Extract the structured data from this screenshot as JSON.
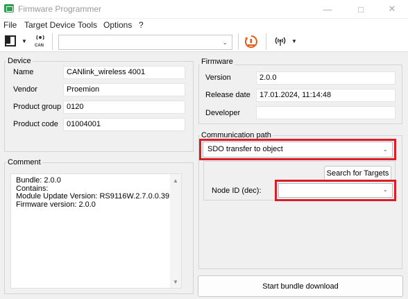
{
  "window": {
    "title": "Firmware Programmer"
  },
  "menu": [
    "File",
    "Target Device",
    "Tools",
    "Options",
    "?"
  ],
  "toolbar": {
    "can_label": "CAN",
    "device_combo_value": "",
    "stop_label": ""
  },
  "device": {
    "title": "Device",
    "fields": [
      {
        "label": "Name",
        "value": "CANlink_wireless 4001"
      },
      {
        "label": "Vendor",
        "value": "Proemion"
      },
      {
        "label": "Product group",
        "value": "0120"
      },
      {
        "label": "Product code",
        "value": "01004001"
      }
    ]
  },
  "firmware": {
    "title": "Firmware",
    "fields": [
      {
        "label": "Version",
        "value": "2.0.0"
      },
      {
        "label": "Release date",
        "value": "17.01.2024, 11:14:48"
      },
      {
        "label": "Developer",
        "value": ""
      }
    ]
  },
  "comment": {
    "title": "Comment",
    "text": "Bundle: 2.0.0\nContains:\nModule Update Version: RS9116W.2.7.0.0.39\nFirmware version: 2.0.0"
  },
  "communication": {
    "title": "Communication path",
    "path_value": "SDO transfer to object",
    "search_button": "Search for Targets",
    "node_label": "Node ID (dec):",
    "node_value": ""
  },
  "actions": {
    "start_button": "Start bundle download"
  },
  "colors": {
    "highlight": "#d91e2a",
    "app_icon": "#2e9e4f"
  }
}
